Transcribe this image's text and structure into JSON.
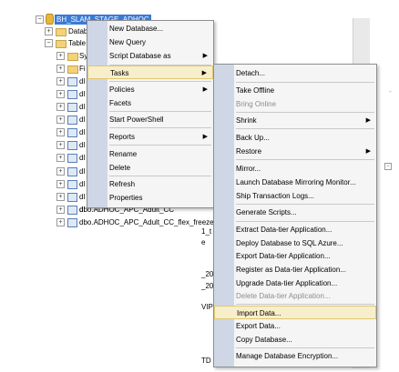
{
  "tree": {
    "server_label": "BH_SLAM_STAGE_ADHOC",
    "items_left": [
      "Datab",
      "Table",
      "Sy",
      "Fi",
      "dl",
      "dl",
      "dl",
      "dl",
      "dl",
      "dl",
      "dl",
      "dl",
      "dl",
      "dl",
      "dl"
    ],
    "tail_items": [
      "dbo.ADHOC_APC_Adult_CC",
      "dbo.ADHOC_APC_Adult_CC_flex_freeze"
    ],
    "behind_fragments": [
      "1_t",
      "e",
      "_20",
      "_20",
      "VIP",
      "TD"
    ]
  },
  "context_menu": {
    "items": [
      {
        "label": "New Database...",
        "submenu": false
      },
      {
        "label": "New Query",
        "submenu": false
      },
      {
        "label": "Script Database as",
        "submenu": true
      },
      {
        "label": "Tasks",
        "submenu": true,
        "highlighted": true
      },
      {
        "label": "Policies",
        "submenu": true
      },
      {
        "label": "Facets",
        "submenu": false
      },
      {
        "label": "Start PowerShell",
        "submenu": false
      },
      {
        "label": "Reports",
        "submenu": true
      },
      {
        "label": "Rename",
        "submenu": false
      },
      {
        "label": "Delete",
        "submenu": false
      },
      {
        "label": "Refresh",
        "submenu": false
      },
      {
        "label": "Properties",
        "submenu": false
      }
    ]
  },
  "tasks_menu": {
    "items": [
      {
        "label": "Detach...",
        "enabled": true
      },
      {
        "label": "Take Offline",
        "enabled": true
      },
      {
        "label": "Bring Online",
        "enabled": false
      },
      {
        "label": "Shrink",
        "enabled": true,
        "submenu": true
      },
      {
        "label": "Back Up...",
        "enabled": true
      },
      {
        "label": "Restore",
        "enabled": true,
        "submenu": true
      },
      {
        "label": "Mirror...",
        "enabled": true
      },
      {
        "label": "Launch Database Mirroring Monitor...",
        "enabled": true
      },
      {
        "label": "Ship Transaction Logs...",
        "enabled": true
      },
      {
        "label": "Generate Scripts...",
        "enabled": true
      },
      {
        "label": "Extract Data-tier Application...",
        "enabled": true
      },
      {
        "label": "Deploy Database to SQL Azure...",
        "enabled": true
      },
      {
        "label": "Export Data-tier Application...",
        "enabled": true
      },
      {
        "label": "Register as Data-tier Application...",
        "enabled": true
      },
      {
        "label": "Upgrade Data-tier Application...",
        "enabled": true
      },
      {
        "label": "Delete Data-tier Application...",
        "enabled": false
      },
      {
        "label": "Import Data...",
        "enabled": true,
        "highlighted": true
      },
      {
        "label": "Export Data...",
        "enabled": true
      },
      {
        "label": "Copy Database...",
        "enabled": true
      },
      {
        "label": "Manage Database Encryption...",
        "enabled": true
      }
    ]
  },
  "icons": {
    "expand": "expand-plus-icon",
    "collapse": "collapse-minus-icon",
    "database": "database-icon",
    "folder": "folder-icon",
    "table": "table-icon",
    "submenu_arrow": "submenu-arrow-icon"
  },
  "colors": {
    "selection": "#3a7bd5",
    "menu_gutter": "#cfd7e6",
    "menu_highlight": "#f7eecb",
    "disabled_text": "#8d8d8d"
  }
}
